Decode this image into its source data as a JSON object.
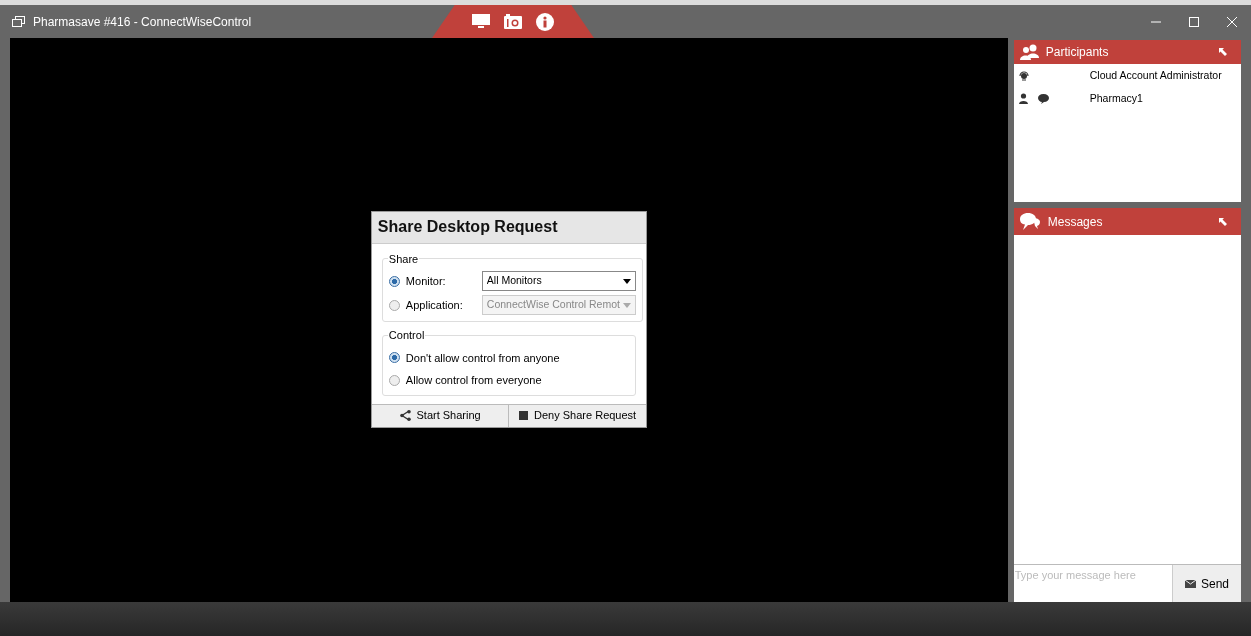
{
  "window": {
    "title": "Pharmasave #416 - ConnectWiseControl"
  },
  "participants": {
    "title": "Participants",
    "items": [
      {
        "kind": "host",
        "name": "Cloud Account Administrator"
      },
      {
        "kind": "guest",
        "name": "Pharmacy1"
      }
    ]
  },
  "messages": {
    "title": "Messages",
    "input": {
      "placeholder": "Type your message here"
    },
    "send": "Send"
  },
  "dialog": {
    "title": "Share Desktop Request",
    "share": {
      "legend": "Share",
      "options": [
        {
          "label": "Monitor:",
          "selected": true,
          "value": "All Monitors",
          "disabled": false
        },
        {
          "label": "Application:",
          "selected": false,
          "value": "ConnectWise Control Remot",
          "disabled": true
        }
      ]
    },
    "control": {
      "legend": "Control",
      "options": [
        {
          "label": "Don't allow control from anyone",
          "selected": true
        },
        {
          "label": "Allow control from everyone",
          "selected": false
        }
      ]
    },
    "buttons": [
      {
        "kind": "share",
        "label": "Start Sharing"
      },
      {
        "kind": "deny",
        "label": "Deny Share Request"
      }
    ]
  }
}
